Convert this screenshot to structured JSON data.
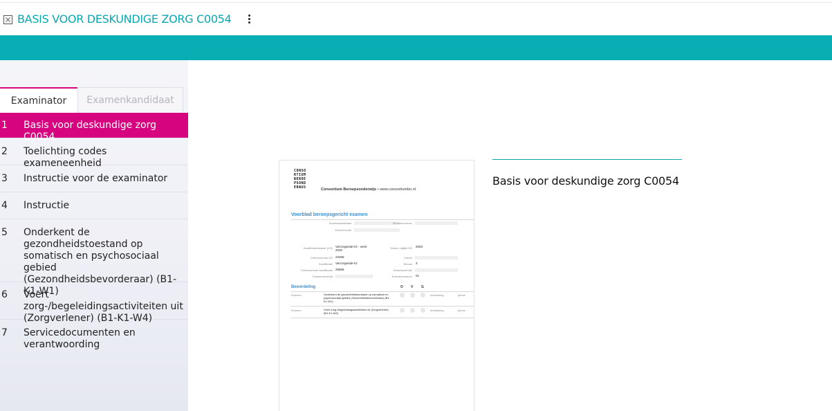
{
  "header": {
    "title": "BASIS VOOR DESKUNDIGE ZORG C0054",
    "close_icon": "close-box-icon",
    "menu_icon": "kebab-menu-icon"
  },
  "colors": {
    "accent_teal": "#09aeb5",
    "active_magenta": "#d6047e"
  },
  "sidebar": {
    "tabs": [
      {
        "label": "Examinator",
        "active": true
      },
      {
        "label": "Examenkandidaat",
        "active": false
      }
    ],
    "items": [
      {
        "num": "1",
        "label": "Basis voor deskundige zorg C0054",
        "active": true
      },
      {
        "num": "2",
        "label": "Toelichting codes exameneenheid"
      },
      {
        "num": "3",
        "label": "Instructie voor de examinator"
      },
      {
        "num": "4",
        "label": "Instructie"
      },
      {
        "num": "5",
        "label": "Onderkent de gezondheidstoestand op somatisch en psychosociaal gebied (Gezondheidsbevorderaar) (B1-K1-W1)"
      },
      {
        "num": "6",
        "label": "Voert zorg-/begeleidingsactiviteiten uit (Zorgverlener) (B1-K1-W4)"
      },
      {
        "num": "7",
        "label": "Servicedocumenten en verantwoording"
      }
    ]
  },
  "preview": {
    "logo_rows": [
      "CONSO",
      "RTIUM",
      "BEROE",
      "PSOND",
      "ERWUS"
    ],
    "org_name": "Consortium Beroepsonderwijs",
    "org_url": "• www.consortiumbo.nl",
    "heading": "Voorblad beroepsgericht examen",
    "labels": {
      "examenkandidaat": "Examenkandidaat",
      "studentnummer": "Studentnummer",
      "examencode": "Examencode",
      "kwalificatiedossier": "Kwalificatiedossier (KD)",
      "datum_kd": "Datum uitgifte KD",
      "crebo_kd": "Crebonummer KD",
      "cohort": "Cohort",
      "kwalificatie": "Kwalificatie",
      "niveau": "Niveau",
      "crebo_kwal": "Crebonummer kwalificatie",
      "afnameperiode": "Afnameperiode",
      "exameneenheid": "Exameneenheid",
      "examennummer": "Examennummer"
    },
    "values": {
      "kwalificatiedossier": "Verzorgende-IG - serie 2020",
      "datum_kd": "2020",
      "crebo_kd": "23268",
      "kwalificatie": "Verzorgende-IG",
      "niveau": "3",
      "crebo_kwal": "25656",
      "examennummer": "01"
    },
    "beoordeling": "Beoordeling",
    "ovg": [
      "O",
      "V",
      "G"
    ],
    "exams": [
      {
        "label": "Examen",
        "text": "Onderkent de gezondheidstoestand op somatisch en psychosociaal gebied (Gezondheidsbevorderaar) (B1-K1-W1)",
        "herkansing": "herkansing",
        "jn": "ja/nee"
      },
      {
        "label": "Examen",
        "text": "Voert zorg-/begeleidingsactiviteiten uit (Zorgverlener) (B1-K1-W4)",
        "herkansing": "herkansing",
        "jn": "ja/nee"
      }
    ]
  },
  "info": {
    "title": "Basis voor deskundige zorg C0054"
  }
}
